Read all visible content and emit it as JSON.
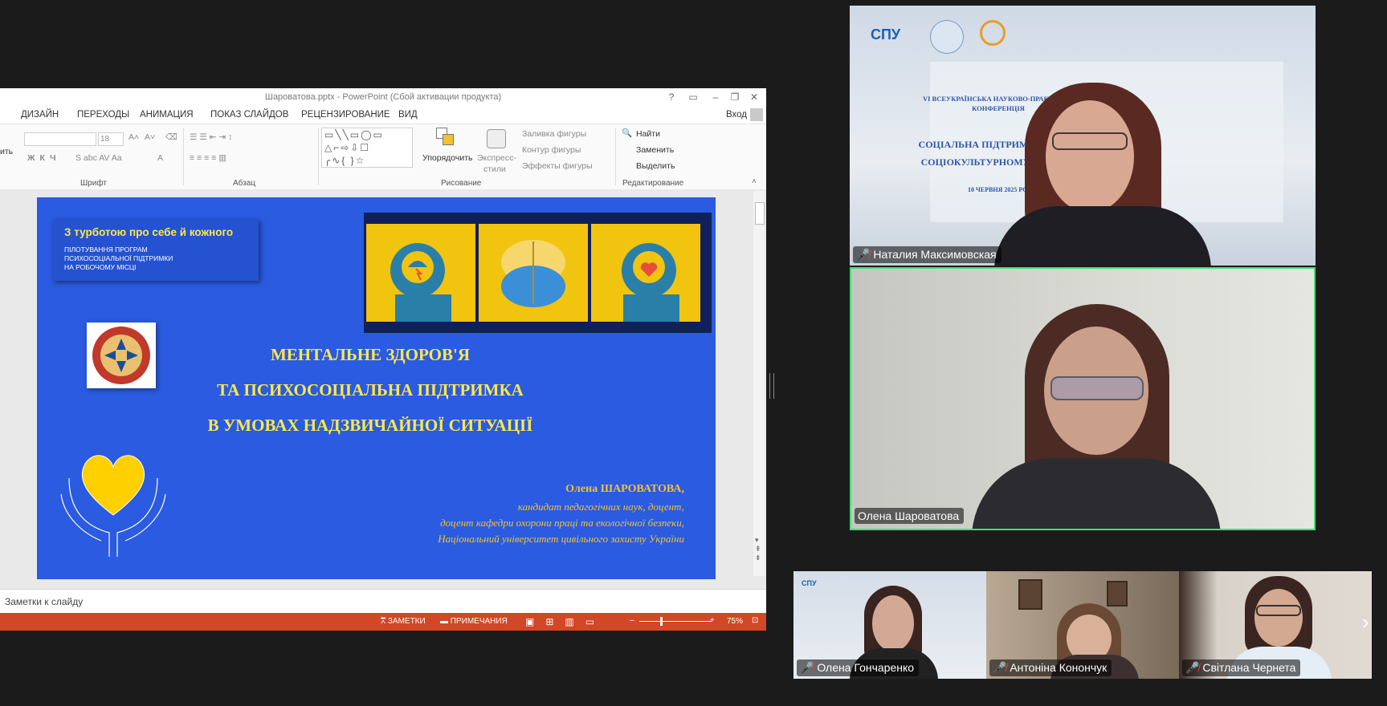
{
  "ppt": {
    "window_title": "Шароватова.pptx - PowerPoint (Сбой активации продукта)",
    "help": "?",
    "sign_in": "Вход",
    "tabs": [
      "ДИЗАЙН",
      "ПЕРЕХОДЫ",
      "АНИМАЦИЯ",
      "ПОКАЗ СЛАЙДОВ",
      "РЕЦЕНЗИРОВАНИЕ",
      "ВИД"
    ],
    "ribbon": {
      "paste_label": "ить",
      "font_size": "18",
      "groups": [
        "Шрифт",
        "Абзац",
        "Рисование",
        "Редактирование"
      ],
      "arrange": "Упорядочить",
      "quick_styles_1": "Экспресс-",
      "quick_styles_2": "стили",
      "shape_fill": "Заливка фигуры",
      "shape_outline": "Контур фигуры",
      "shape_effects": "Эффекты фигуры",
      "find": "Найти",
      "replace": "Заменить",
      "select": "Выделить"
    },
    "notes_placeholder": "Заметки к слайду",
    "status": {
      "notes": "ЗАМЕТКИ",
      "comments": "ПРИМЕЧАНИЯ",
      "zoom": "75%"
    }
  },
  "slide": {
    "box_title": "З турботою про себе й кожного",
    "box_line1": "ПІЛОТУВАННЯ ПРОГРАМ",
    "box_line2": "ПСИХОСОЦІАЛЬНОЇ ПІДТРИМКИ",
    "box_line3": "НА РОБОЧОМУ МІСЦІ",
    "title1": "МЕНТАЛЬНЕ ЗДОРОВ'Я",
    "title2": "ТА ПСИХОСОЦІАЛЬНА ПІДТРИМКА",
    "title3": "В УМОВАХ НАДЗВИЧАЙНОЇ СИТУАЦІЇ",
    "author": "Олена ШАРОВАТОВА,",
    "author_line1": "кандидат педагогічних наук, доцент,",
    "author_line2": "доцент кафедри охорони праці та екологічної безпеки,",
    "author_line3": "Національний університет цивільного захисту України"
  },
  "participants": {
    "main": [
      {
        "name": "Наталия Максимовская"
      },
      {
        "name": "Олена Шароватова"
      }
    ],
    "strip": [
      {
        "name": "Олена Гончаренко"
      },
      {
        "name": "Антоніна Конончук"
      },
      {
        "name": "Світлана Чернета"
      }
    ]
  },
  "background_slide": {
    "logo": "СПУ",
    "conf1": "VI ВСЕУКРАЇНСЬКА НАУКОВО-ПРАКТИЧНА",
    "conf2": "КОНФЕРЕНЦІЯ",
    "conf3": "СОЦІАЛЬНА ПІДТРИМКА СІМ'Ї ТА",
    "conf4": "СОЦІОКУЛЬТУРНОМУ ПРОСТОРІ",
    "conf_date": "10 ЧЕРВНЯ 2025 РОКУ"
  },
  "colors": {
    "accent_ppt": "#d24726",
    "slide_blue": "#2a5be0",
    "slide_yellow": "#ffe84a",
    "speaker_border": "#3fe07a"
  }
}
